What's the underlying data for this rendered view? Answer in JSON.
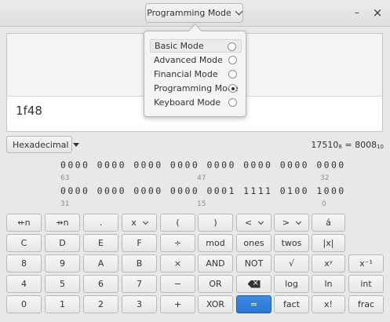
{
  "header": {
    "mode_button_label": "Programming Mode",
    "minimize_symbol": "–",
    "close_symbol": "×"
  },
  "display": {
    "value": "1f48"
  },
  "base_selector": {
    "label": "Hexadecimal"
  },
  "conversion": {
    "left_value": "17510",
    "left_base": "8",
    "equals": "=",
    "right_value": "8008",
    "right_base": "10"
  },
  "bits": {
    "row1": "0000 0000 0000 0000 0000 0000 0000 0000",
    "row1_positions": [
      "63",
      "47",
      "32"
    ],
    "row2": "0000 0000 0000 0000 0001 1111 0100 1000",
    "row2_positions": [
      "31",
      "15",
      "0"
    ]
  },
  "keypad": {
    "row1": [
      "⇷n",
      "⇸n",
      ".",
      "x",
      "(",
      ")",
      "<",
      ">",
      "á"
    ],
    "row2": [
      "C",
      "D",
      "E",
      "F",
      "mod",
      "ones",
      "twos",
      "|x|"
    ],
    "row3": [
      "8",
      "9",
      "A",
      "B",
      "×",
      "AND",
      "NOT",
      "√",
      "xʸ",
      "x⁻¹"
    ],
    "row4": [
      "4",
      "5",
      "6",
      "7",
      "−",
      "OR",
      "",
      "log",
      "ln",
      "int"
    ],
    "row5": [
      "0",
      "1",
      "2",
      "3",
      "+",
      "XOR",
      "=",
      "fact",
      "x!",
      "frac"
    ],
    "row2_extra": "÷"
  },
  "mode_menu": {
    "items": [
      {
        "label": "Basic Mode",
        "selected": false
      },
      {
        "label": "Advanced Mode",
        "selected": false
      },
      {
        "label": "Financial Mode",
        "selected": false
      },
      {
        "label": "Programming Mode",
        "selected": true
      },
      {
        "label": "Keyboard Mode",
        "selected": false
      }
    ]
  },
  "colors": {
    "accent": "#3584e4",
    "background": "#e8e8e7"
  }
}
